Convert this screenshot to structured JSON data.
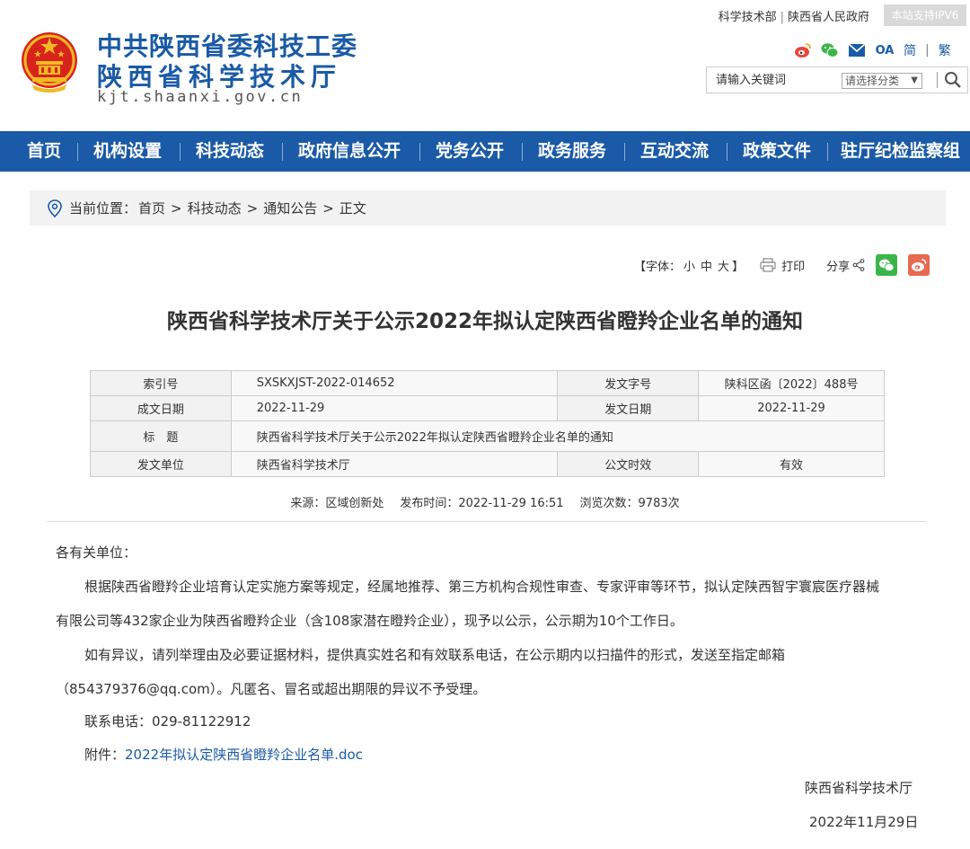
{
  "header": {
    "name_line1": "中共陕西省委科技工委",
    "name_line2": "陕西省科学技术厅",
    "domain": "kjt.shaanxi.gov.cn",
    "top_link_1": "科学技术部",
    "top_link_sep": "|",
    "top_link_2": "陕西省人民政府",
    "ipv6_badge": "本站支持IPV6",
    "oa": "OA",
    "lang_simplified": "简",
    "lang_sep": "|",
    "lang_traditional": "繁",
    "search_placeholder": "请输入关键词",
    "search_category": "请选择分类",
    "search_arrow": "▼"
  },
  "nav": {
    "items": [
      "首页",
      "机构设置",
      "科技动态",
      "政府信息公开",
      "党务公开",
      "政务服务",
      "互动交流",
      "政策文件",
      "驻厅纪检监察组"
    ]
  },
  "breadcrumb": {
    "prefix": "当前位置：",
    "items": [
      "首页",
      "科技动态",
      "通知公告",
      "正文"
    ],
    "sep": ">"
  },
  "tools": {
    "font_open": "【字体：",
    "font_small": "小",
    "font_medium": "中",
    "font_large": "大",
    "font_close": "】",
    "print": "打印",
    "share": "分享"
  },
  "article": {
    "title": "陕西省科学技术厅关于公示2022年拟认定陕西省瞪羚企业名单的通知",
    "meta": {
      "index_label": "索引号",
      "index_value": "SXSKXJST-2022-014652",
      "docno_label": "发文字号",
      "docno_value": "陕科区函〔2022〕488号",
      "created_label": "成文日期",
      "created_value": "2022-11-29",
      "issued_label": "发文日期",
      "issued_value": "2022-11-29",
      "title_label": "标　题",
      "title_value": "陕西省科学技术厅关于公示2022年拟认定陕西省瞪羚企业名单的通知",
      "issuer_label": "发文单位",
      "issuer_value": "陕西省科学技术厅",
      "validity_label": "公文时效",
      "validity_value": "有效"
    },
    "source": "来源：区域创新处",
    "publish_time": "发布时间：2022-11-29 16:51",
    "views": "浏览次数：9783次",
    "salutation": "各有关单位：",
    "para1_line1": "根据陕西省瞪羚企业培育认定实施方案等规定，经属地推荐、第三方机构合规性审查、专家评审等环节，拟认定陕西智宇寰宸医疗器械",
    "para1_line2": "有限公司等432家企业为陕西省瞪羚企业（含108家潜在瞪羚企业），现予以公示，公示期为10个工作日。",
    "para2_line1": "如有异议，请列举理由及必要证据材料，提供真实姓名和有效联系电话，在公示期内以扫描件的形式，发送至指定邮箱",
    "para2_line2": "（854379376@qq.com）。凡匿名、冒名或超出期限的异议不予受理。",
    "contact": "联系电话：029-81122912",
    "attachment_prefix": "附件：",
    "attachment_link": "2022年拟认定陕西省瞪羚企业名单.doc",
    "signature": "陕西省科学技术厅",
    "date": "2022年11月29日"
  },
  "colors": {
    "brand_blue": "#1a5aa6",
    "wechat_green": "#3bb54a",
    "weibo_red": "#e8694f"
  }
}
